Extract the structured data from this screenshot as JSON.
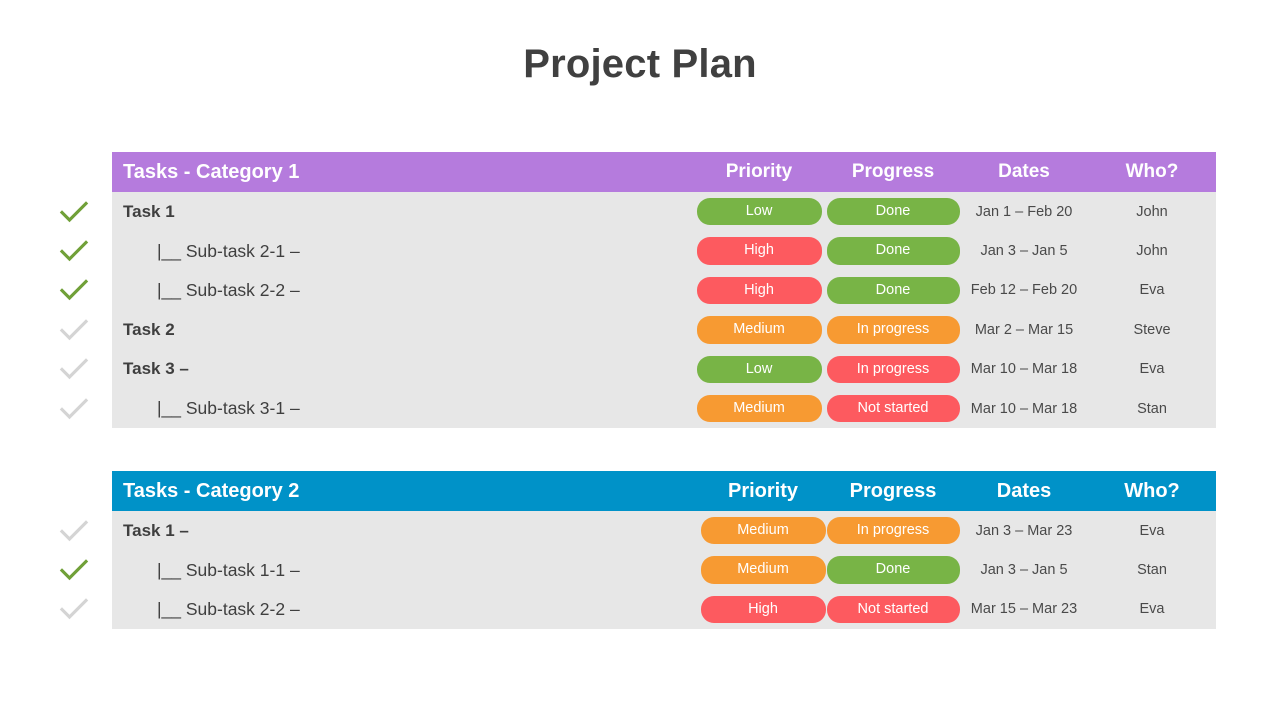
{
  "page": {
    "title": "Project Plan"
  },
  "colors": {
    "category_1_header": "#b57bdd",
    "category_2_header": "#0092c8",
    "row_background": "#e7e7e7",
    "pill_green": "#78b446",
    "pill_orange": "#f79a32",
    "pill_red": "#fd5a5f",
    "check_done": "#70a038",
    "check_pending": "#d4d4d4",
    "title_text": "#404040"
  },
  "columns": {
    "priority": "Priority",
    "progress": "Progress",
    "dates": "Dates",
    "who": "Who?"
  },
  "tables": [
    {
      "id": "table-1",
      "title": "Tasks - Category 1",
      "rows": [
        {
          "check": "check-done-icon",
          "done": true,
          "task": "Task 1",
          "level": "top",
          "priority": "Low",
          "priority_color": "green",
          "progress": "Done",
          "progress_color": "green",
          "dates": "Jan 1 – Feb 20",
          "who": "John"
        },
        {
          "check": "check-done-icon",
          "done": true,
          "task": "|__ Sub-task 2-1 –",
          "level": "sub",
          "priority": "High",
          "priority_color": "red",
          "progress": "Done",
          "progress_color": "green",
          "dates": "Jan 3 – Jan 5",
          "who": "John"
        },
        {
          "check": "check-done-icon",
          "done": true,
          "task": "|__ Sub-task 2-2 –",
          "level": "sub",
          "priority": "High",
          "priority_color": "red",
          "progress": "Done",
          "progress_color": "green",
          "dates": "Feb 12 – Feb 20",
          "who": "Eva"
        },
        {
          "check": "check-pending-icon",
          "done": false,
          "task": "Task 2",
          "level": "top",
          "priority": "Medium",
          "priority_color": "orange",
          "progress": "In progress",
          "progress_color": "orange",
          "dates": "Mar 2 – Mar 15",
          "who": "Steve"
        },
        {
          "check": "check-pending-icon",
          "done": false,
          "task": "Task 3 –",
          "level": "top",
          "priority": "Low",
          "priority_color": "green",
          "progress": "In progress",
          "progress_color": "red",
          "dates": "Mar 10 – Mar 18",
          "who": "Eva"
        },
        {
          "check": "check-pending-icon",
          "done": false,
          "task": "|__ Sub-task 3-1 –",
          "level": "sub",
          "priority": "Medium",
          "priority_color": "orange",
          "progress": "Not started",
          "progress_color": "red",
          "dates": "Mar 10 – Mar 18",
          "who": "Stan"
        }
      ]
    },
    {
      "id": "table-2",
      "title": "Tasks - Category 2",
      "rows": [
        {
          "check": "check-pending-icon",
          "done": false,
          "task": "Task 1 –",
          "level": "top",
          "priority": "Medium",
          "priority_color": "orange",
          "progress": "In progress",
          "progress_color": "orange",
          "dates": "Jan 3 – Mar 23",
          "who": "Eva"
        },
        {
          "check": "check-done-icon",
          "done": true,
          "task": "|__ Sub-task 1-1 –",
          "level": "sub",
          "priority": "Medium",
          "priority_color": "orange",
          "progress": "Done",
          "progress_color": "green",
          "dates": "Jan 3 – Jan 5",
          "who": "Stan"
        },
        {
          "check": "check-pending-icon",
          "done": false,
          "task": "|__ Sub-task 2-2 –",
          "level": "sub",
          "priority": "High",
          "priority_color": "red",
          "progress": "Not started",
          "progress_color": "red",
          "dates": "Mar 15 – Mar 23",
          "who": "Eva"
        }
      ]
    }
  ]
}
